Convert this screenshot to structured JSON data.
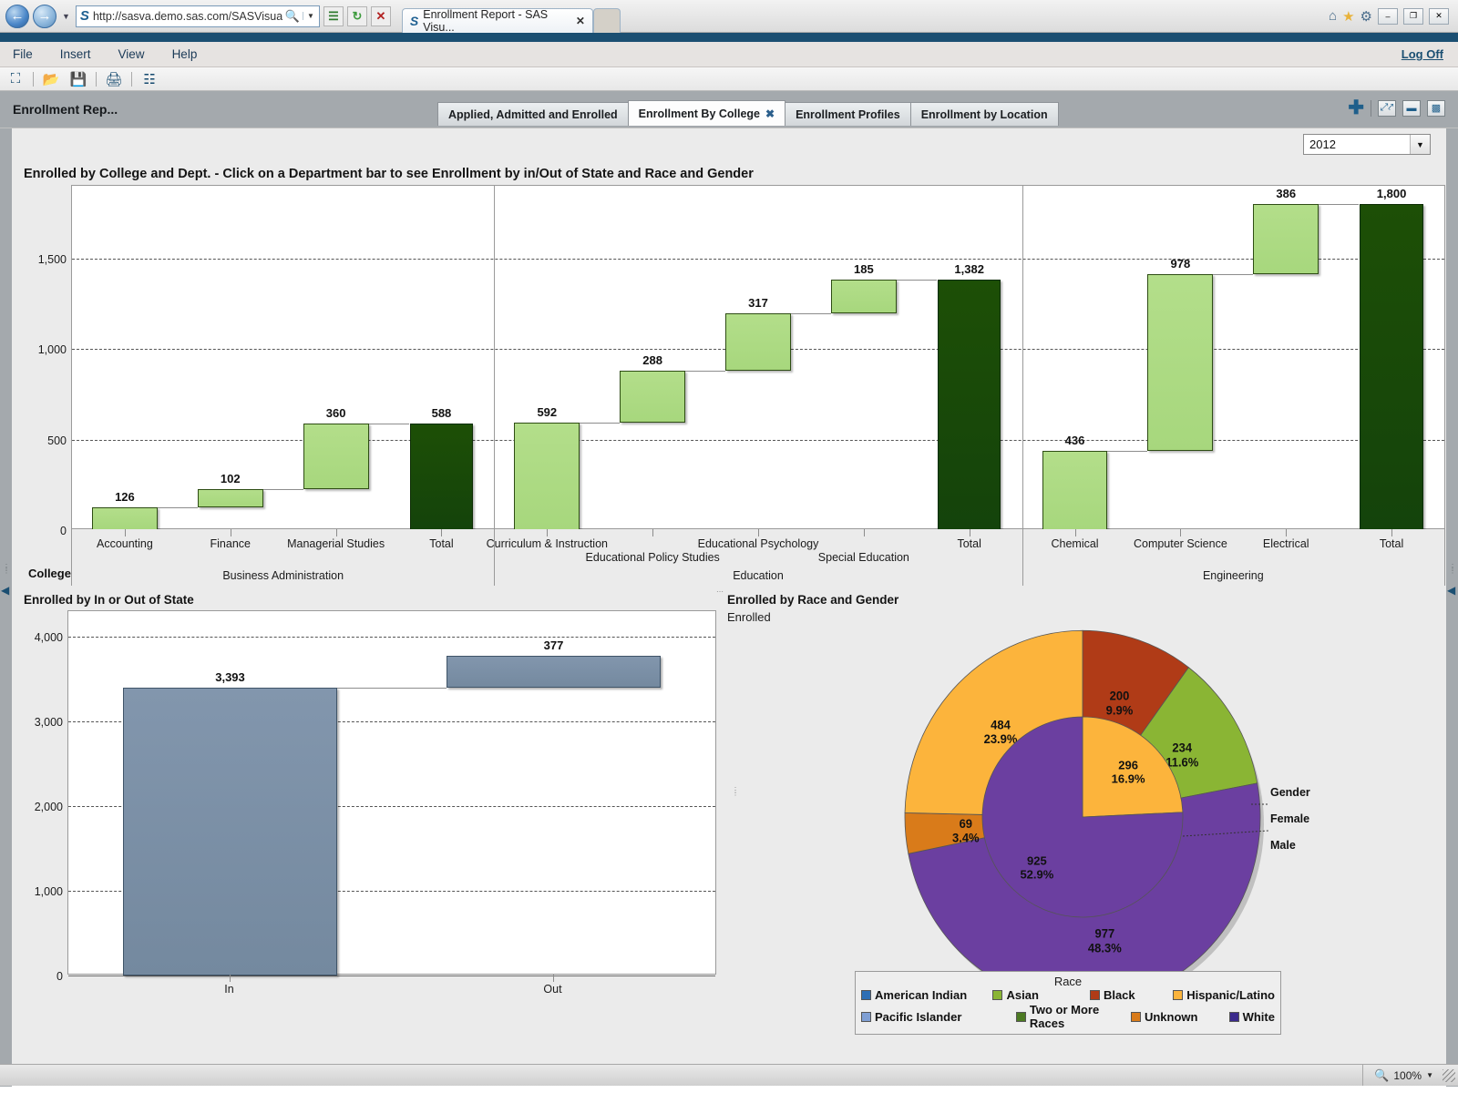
{
  "browser": {
    "url": "http://sasva.demo.sas.com/SASVisualAnalytic",
    "back_icon": "back-arrow-icon",
    "forward_icon": "forward-arrow-icon",
    "tab_title": "Enrollment Report - SAS Visu...",
    "tab_close": "✕",
    "icons": {
      "rss": "≡",
      "refresh": "↻",
      "stop": "✕",
      "home": "⌂",
      "favorites": "★",
      "tools": "⚙"
    },
    "window_buttons": {
      "minimize": "–",
      "maximize": "❐",
      "close": "✕"
    }
  },
  "app": {
    "menu": [
      "File",
      "Insert",
      "View",
      "Help"
    ],
    "logoff": "Log Off",
    "toolbar_icons": [
      "new-report-icon",
      "open-icon",
      "save-icon",
      "print-icon",
      "layout-icon"
    ],
    "report_title": "Enrollment Rep...",
    "tabs": [
      {
        "label": "Applied, Admitted and Enrolled",
        "active": false,
        "closable": false
      },
      {
        "label": "Enrollment By College",
        "active": true,
        "closable": true
      },
      {
        "label": "Enrollment Profiles",
        "active": false,
        "closable": false
      },
      {
        "label": "Enrollment by Location",
        "active": false,
        "closable": false
      }
    ],
    "header_tools": [
      "add-icon",
      "fullscreen-icon",
      "single-pane-icon",
      "split-pane-icon"
    ]
  },
  "filter": {
    "year_value": "2012",
    "dropdown_icon": "chevron-down-icon"
  },
  "status": {
    "zoom": "100%",
    "zoom_icon": "zoom-icon",
    "dropdown_icon": "chevron-down-icon"
  },
  "sections": {
    "waterfall_title": "Enrolled by College and Dept. - Click on a Department bar to see Enrollment by in/Out of State and Race and Gender",
    "instate_title": "Enrolled by In or Out of State",
    "race_title": "Enrolled by Race and Gender",
    "race_subtitle": "Enrolled",
    "axis_group_label": "College"
  },
  "chart_data": [
    {
      "type": "bar",
      "name": "waterfall-enrolled-by-college",
      "title": "Enrolled by College and Dept. - Click on a Department bar to see Enrollment by in/Out of State and Race and Gender",
      "xlabel": "College",
      "ylabel": "",
      "ylim": [
        0,
        1900
      ],
      "yticks": [
        0,
        500,
        1000,
        1500
      ],
      "ytick_labels": [
        "0",
        "500",
        "1,000",
        "1,500"
      ],
      "grid": true,
      "colors": {
        "increment": "#ace07f",
        "total": "#1a4a06"
      },
      "groups": [
        {
          "group": "Business Administration",
          "categories": [
            "Accounting",
            "Finance",
            "Managerial Studies",
            "Total"
          ],
          "values": [
            126,
            102,
            360,
            588
          ],
          "cumulative_start": [
            0,
            126,
            228,
            0
          ],
          "cumulative_end": [
            126,
            228,
            588,
            588
          ],
          "is_total": [
            false,
            false,
            false,
            true
          ]
        },
        {
          "group": "Education",
          "categories": [
            "Curriculum & Instruction",
            "Educational Policy Studies",
            "Educational Psychology",
            "Special Education",
            "Total"
          ],
          "values": [
            592,
            288,
            317,
            185,
            1382
          ],
          "cumulative_start": [
            0,
            592,
            880,
            1197,
            0
          ],
          "cumulative_end": [
            592,
            880,
            1197,
            1382,
            1382
          ],
          "is_total": [
            false,
            false,
            false,
            false,
            true
          ]
        },
        {
          "group": "Engineering",
          "categories": [
            "Chemical",
            "Computer Science",
            "Electrical",
            "Total"
          ],
          "values": [
            436,
            978,
            386,
            1800
          ],
          "cumulative_start": [
            0,
            436,
            1414,
            0
          ],
          "cumulative_end": [
            436,
            1414,
            1800,
            1800
          ],
          "is_total": [
            false,
            false,
            false,
            true
          ]
        }
      ]
    },
    {
      "type": "bar",
      "name": "enrolled-by-in-or-out-of-state",
      "title": "Enrolled by In or Out of State",
      "categories": [
        "In",
        "Out"
      ],
      "values": [
        3393,
        377
      ],
      "value_labels": [
        "3,393",
        "377"
      ],
      "cumulative_start": [
        0,
        3393
      ],
      "cumulative_end": [
        3393,
        3770
      ],
      "ylim": [
        0,
        4300
      ],
      "yticks": [
        0,
        1000,
        2000,
        3000,
        4000
      ],
      "ytick_labels": [
        "0",
        "1,000",
        "2,000",
        "3,000",
        "4,000"
      ],
      "grid": true,
      "color": "#7d91a8"
    },
    {
      "type": "pie",
      "name": "enrolled-by-race-and-gender",
      "title": "Enrolled by Race and Gender",
      "subtitle": "Enrolled",
      "legend_title": "Race",
      "legend_position": "bottom",
      "ring_labels": [
        "Gender",
        "Female",
        "Male"
      ],
      "inner_ring": {
        "name": "Female",
        "slices": [
          {
            "label": "Hispanic/Latino",
            "value": 296,
            "percent": "16.9%",
            "color": "#fcb43c",
            "show_label": true
          },
          {
            "label": "Black",
            "value": 0,
            "percent": "",
            "color": "#b03b17",
            "show_label": false
          },
          {
            "label": "Asian",
            "value": 0,
            "percent": "",
            "color": "#8ab534",
            "show_label": false
          },
          {
            "label": "American Indian",
            "value": 0,
            "percent": "",
            "color": "#2f6fb5",
            "show_label": false
          },
          {
            "label": "White",
            "value": 925,
            "percent": "52.9%",
            "color": "#6b3fa0",
            "show_label": true
          },
          {
            "label": "Unknown",
            "value": 0,
            "percent": "",
            "color": "#d97b1a",
            "show_label": false
          },
          {
            "label": "Two or More Races",
            "value": 0,
            "percent": "",
            "color": "#4c7a22",
            "show_label": false
          }
        ]
      },
      "outer_ring": {
        "name": "Male",
        "slices": [
          {
            "label": "Black",
            "value": 200,
            "percent": "9.9%",
            "color": "#b03b17",
            "show_label": true
          },
          {
            "label": "Asian",
            "value": 234,
            "percent": "11.6%",
            "color": "#8ab534",
            "show_label": true
          },
          {
            "label": "American Indian",
            "value": 0,
            "percent": "",
            "color": "#2f6fb5",
            "show_label": false
          },
          {
            "label": "White",
            "value": 977,
            "percent": "48.3%",
            "color": "#6b3fa0",
            "show_label": true
          },
          {
            "label": "Unknown",
            "value": 69,
            "percent": "3.4%",
            "color": "#d97b1a",
            "show_label": true
          },
          {
            "label": "Two or More Races",
            "value": 0,
            "percent": "",
            "color": "#4c7a22",
            "show_label": false
          },
          {
            "label": "Hispanic/Latino",
            "value": 484,
            "percent": "23.9%",
            "color": "#fcb43c",
            "show_label": true
          }
        ]
      },
      "legend": [
        {
          "label": "American Indian",
          "color": "#2f6fb5"
        },
        {
          "label": "Asian",
          "color": "#8ab534"
        },
        {
          "label": "Black",
          "color": "#b03b17"
        },
        {
          "label": "Hispanic/Latino",
          "color": "#fcb43c"
        },
        {
          "label": "Pacific Islander",
          "color": "#7f9fd4"
        },
        {
          "label": "Two or More Races",
          "color": "#4c7a22"
        },
        {
          "label": "Unknown",
          "color": "#d97b1a"
        },
        {
          "label": "White",
          "color": "#3b2a8c"
        }
      ]
    }
  ]
}
